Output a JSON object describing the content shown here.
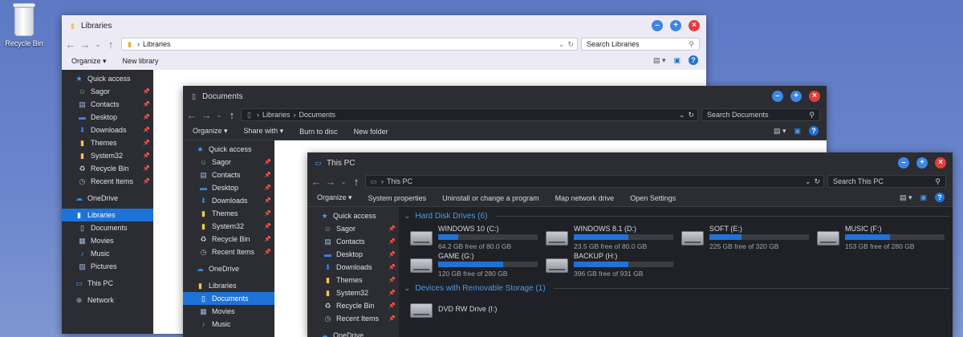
{
  "desktop": {
    "recycle_bin": "Recycle Bin"
  },
  "common_nav": {
    "back": "←",
    "forward": "→",
    "recent": "⌄",
    "up": "↑",
    "sep": "›",
    "drop": "⌄",
    "refresh": "↻",
    "search_icon": "search-icon"
  },
  "libraries_window": {
    "title": "Libraries",
    "address": "Libraries",
    "search_placeholder": "Search Libraries",
    "commands": [
      "Organize ▾",
      "New library"
    ],
    "sidebar": [
      {
        "label": "Quick access",
        "icon": "star-icon"
      },
      {
        "label": "Sagor",
        "icon": "user-icon",
        "pin": true
      },
      {
        "label": "Contacts",
        "icon": "contacts-icon",
        "pin": true
      },
      {
        "label": "Desktop",
        "icon": "desktop-icon",
        "pin": true
      },
      {
        "label": "Downloads",
        "icon": "download-icon",
        "pin": true
      },
      {
        "label": "Themes",
        "icon": "folder-icon",
        "pin": true
      },
      {
        "label": "System32",
        "icon": "folder-icon",
        "pin": true
      },
      {
        "label": "Recycle Bin",
        "icon": "recycle-bin-icon",
        "pin": true
      },
      {
        "label": "Recent Items",
        "icon": "recent-icon",
        "pin": true
      },
      {
        "label": "OneDrive",
        "icon": "cloud-icon"
      },
      {
        "label": "Libraries",
        "icon": "library-icon",
        "selected": true
      },
      {
        "label": "Documents",
        "icon": "document-icon"
      },
      {
        "label": "Movies",
        "icon": "movie-icon"
      },
      {
        "label": "Music",
        "icon": "music-icon"
      },
      {
        "label": "Pictures",
        "icon": "picture-icon"
      },
      {
        "label": "This PC",
        "icon": "computer-icon"
      },
      {
        "label": "Network",
        "icon": "network-icon"
      }
    ]
  },
  "documents_window": {
    "title": "Documents",
    "address": [
      "Libraries",
      "Documents"
    ],
    "search_placeholder": "Search Documents",
    "commands": [
      "Organize ▾",
      "Share with ▾",
      "Burn to disc",
      "New folder"
    ],
    "sidebar": [
      {
        "label": "Quick access",
        "icon": "star-icon"
      },
      {
        "label": "Sagor",
        "icon": "user-icon",
        "pin": true
      },
      {
        "label": "Contacts",
        "icon": "contacts-icon",
        "pin": true
      },
      {
        "label": "Desktop",
        "icon": "desktop-icon",
        "pin": true
      },
      {
        "label": "Downloads",
        "icon": "download-icon",
        "pin": true
      },
      {
        "label": "Themes",
        "icon": "folder-icon",
        "pin": true
      },
      {
        "label": "System32",
        "icon": "folder-icon",
        "pin": true
      },
      {
        "label": "Recycle Bin",
        "icon": "recycle-bin-icon",
        "pin": true
      },
      {
        "label": "Recent Items",
        "icon": "recent-icon",
        "pin": true
      },
      {
        "label": "OneDrive",
        "icon": "cloud-icon"
      },
      {
        "label": "Libraries",
        "icon": "library-icon"
      },
      {
        "label": "Documents",
        "icon": "document-icon",
        "selected": true
      },
      {
        "label": "Movies",
        "icon": "movie-icon"
      },
      {
        "label": "Music",
        "icon": "music-icon"
      }
    ]
  },
  "thispc_window": {
    "title": "This PC",
    "address": [
      "This PC"
    ],
    "search_placeholder": "Search This PC",
    "commands": [
      "Organize ▾",
      "System properties",
      "Uninstall or change a program",
      "Map network drive",
      "Open Settings"
    ],
    "sidebar": [
      {
        "label": "Quick access",
        "icon": "star-icon"
      },
      {
        "label": "Sagor",
        "icon": "user-icon",
        "pin": true
      },
      {
        "label": "Contacts",
        "icon": "contacts-icon",
        "pin": true
      },
      {
        "label": "Desktop",
        "icon": "desktop-icon",
        "pin": true
      },
      {
        "label": "Downloads",
        "icon": "download-icon",
        "pin": true
      },
      {
        "label": "Themes",
        "icon": "folder-icon",
        "pin": true
      },
      {
        "label": "System32",
        "icon": "folder-icon",
        "pin": true
      },
      {
        "label": "Recycle Bin",
        "icon": "recycle-bin-icon",
        "pin": true
      },
      {
        "label": "Recent Items",
        "icon": "recent-icon",
        "pin": true
      },
      {
        "label": "OneDrive",
        "icon": "cloud-icon"
      }
    ],
    "hdd_group": "Hard Disk Drives (6)",
    "drives": [
      {
        "name": "WINDOWS 10 (C:)",
        "free": "64.2 GB free of 80.0 GB",
        "used_fraction": 0.2
      },
      {
        "name": "WINDOWS 8.1 (D:)",
        "free": "23.5 GB free of 80.0 GB",
        "used_fraction": 0.55
      },
      {
        "name": "SOFT (E:)",
        "free": "225 GB free of 320 GB",
        "used_fraction": 0.32
      },
      {
        "name": "MUSIC (F:)",
        "free": "153 GB free of 280 GB",
        "used_fraction": 0.45
      },
      {
        "name": "GAME (G:)",
        "free": "120 GB free of 280 GB",
        "used_fraction": 0.65
      },
      {
        "name": "BACKUP (H:)",
        "free": "396 GB free of 931 GB",
        "used_fraction": 0.55
      }
    ],
    "removable_group": "Devices with Removable Storage (1)",
    "removable": [
      {
        "name": "DVD RW Drive (I:)"
      }
    ]
  },
  "colors": {
    "accent": "#1e73d8",
    "close": "#e43d3d",
    "group_header": "#4b9be8"
  }
}
